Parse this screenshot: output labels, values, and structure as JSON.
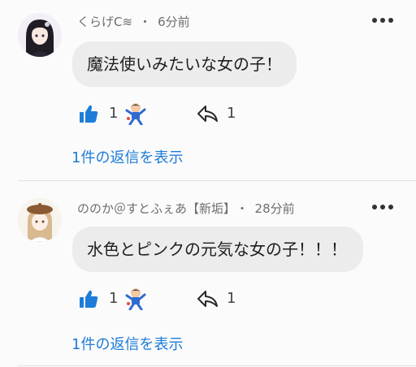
{
  "comments": [
    {
      "author": "くらげC≋",
      "time": "6分前",
      "text": "魔法使いみたいな女の子！",
      "likes": "1",
      "shares": "1",
      "replies_label": "1件の返信を表示",
      "avatar_icon": "avatar-dark-hair-girl"
    },
    {
      "author": "ののか＠すとふぇあ【新垢】",
      "time": "28分前",
      "text": "水色とピンクの元気な女の子！！！",
      "likes": "1",
      "shares": "1",
      "replies_label": "1件の返信を表示",
      "avatar_icon": "avatar-beret-girl"
    }
  ],
  "separator": "・",
  "colors": {
    "accent": "#1d7cd9",
    "bubble": "#ececec",
    "meta": "#6e6e6e"
  }
}
